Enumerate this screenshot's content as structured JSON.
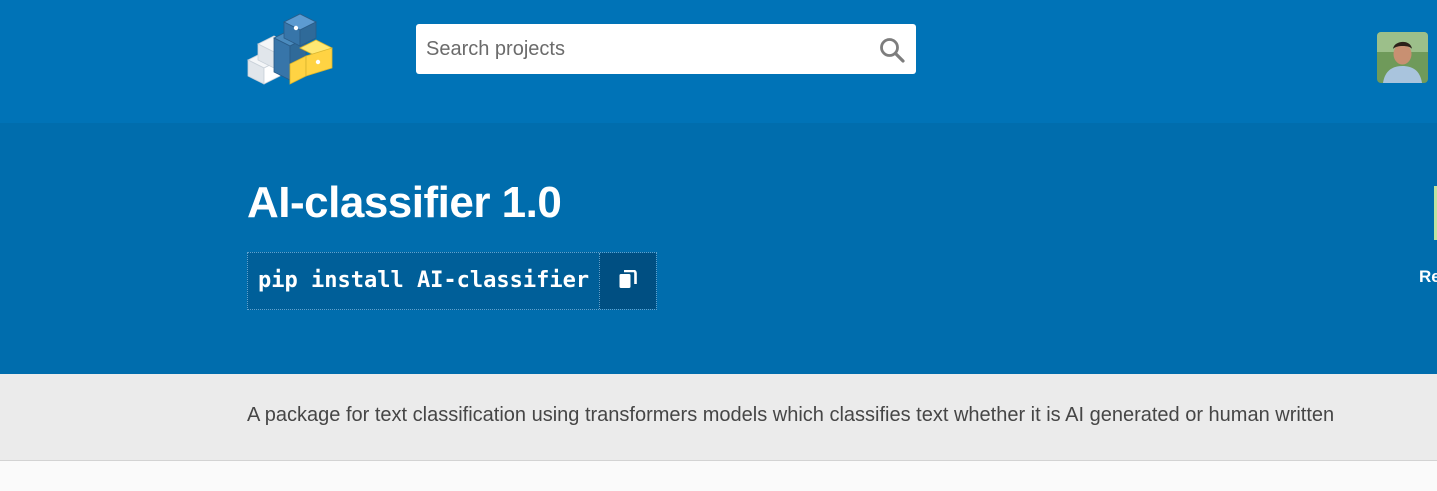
{
  "header": {
    "logo_icon": "pypi-logo-icon",
    "search": {
      "placeholder": "Search projects",
      "value": "",
      "icon": "search-icon"
    },
    "avatar_icon": "user-avatar"
  },
  "package": {
    "title": "AI-classifier 1.0",
    "install_command": "pip install AI-classifier",
    "copy_icon": "copy-icon",
    "side_text": "Re"
  },
  "description": {
    "summary": "A package for text classification using transformers models which classifies text whether it is AI generated or human written"
  },
  "colors": {
    "topbar": "#0073b7",
    "banner": "#006dad",
    "description_band": "#ebebeb",
    "logo_yellow": "#ffd343",
    "logo_blue": "#3775a9"
  }
}
